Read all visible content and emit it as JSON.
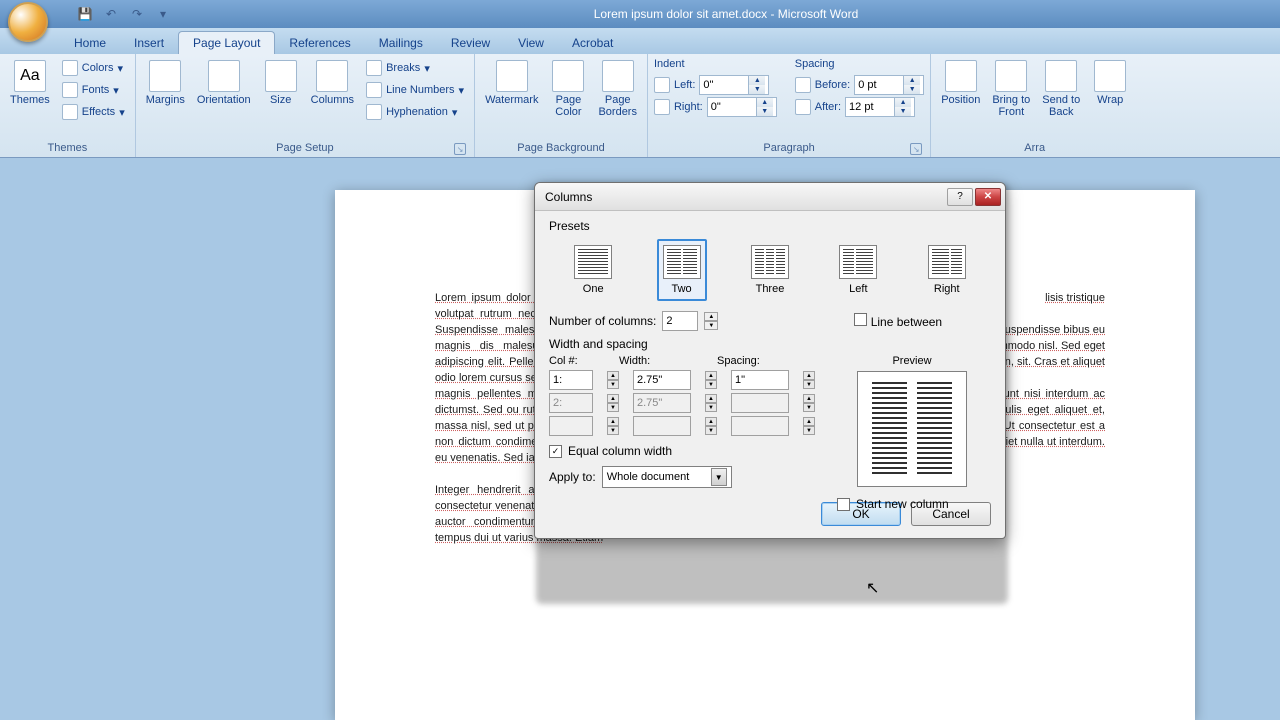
{
  "title": "Lorem ipsum dolor sit amet.docx - Microsoft Word",
  "tabs": [
    "Home",
    "Insert",
    "Page Layout",
    "References",
    "Mailings",
    "Review",
    "View",
    "Acrobat"
  ],
  "active_tab": 2,
  "ribbon": {
    "themes": {
      "label": "Themes",
      "main": "Themes",
      "colors": "Colors",
      "fonts": "Fonts",
      "effects": "Effects"
    },
    "page_setup": {
      "label": "Page Setup",
      "margins": "Margins",
      "orientation": "Orientation",
      "size": "Size",
      "columns": "Columns",
      "breaks": "Breaks",
      "line_numbers": "Line Numbers",
      "hyphenation": "Hyphenation"
    },
    "page_background": {
      "label": "Page Background",
      "watermark": "Watermark",
      "page_color": "Page\nColor",
      "page_borders": "Page\nBorders"
    },
    "paragraph": {
      "label": "Paragraph",
      "indent": "Indent",
      "left": "Left:",
      "right": "Right:",
      "left_val": "0\"",
      "right_val": "0\"",
      "spacing": "Spacing",
      "before": "Before:",
      "after": "After:",
      "before_val": "0 pt",
      "after_val": "12 pt"
    },
    "arrange": {
      "label": "Arra",
      "position": "Position",
      "bring_front": "Bring to\nFront",
      "send_back": "Send to\nBack",
      "wrap": "Wrap"
    }
  },
  "dialog": {
    "title": "Columns",
    "presets_label": "Presets",
    "presets": [
      "One",
      "Two",
      "Three",
      "Left",
      "Right"
    ],
    "selected_preset": 1,
    "num_cols_label": "Number of columns:",
    "num_cols": "2",
    "line_between": "Line between",
    "width_spacing_label": "Width and spacing",
    "col_header": "Col #:",
    "width_header": "Width:",
    "spacing_header": "Spacing:",
    "rows": [
      {
        "num": "1:",
        "width": "2.75\"",
        "spacing": "1\""
      },
      {
        "num": "2:",
        "width": "2.75\"",
        "spacing": ""
      },
      {
        "num": "",
        "width": "",
        "spacing": ""
      }
    ],
    "equal_width": "Equal column width",
    "equal_checked": true,
    "preview_label": "Preview",
    "start_new_col": "Start new column",
    "apply_to_label": "Apply to:",
    "apply_to": "Whole document",
    "ok": "OK",
    "cancel": "Cancel"
  },
  "document": {
    "col1a": "Lorem ipsum dolor sit amet, consectetur adipiscing elit. Proin volutpat rutrum nec nisi faucibus, enim   ac   magna   interdum. Suspendisse malesuada orci volutpat scelerisque orci. Cras magnis dis malesuada orci. Sed eget auctor elementum adipiscing elit. Pellentesque feugiat in. Donec   faucer   mi   urna   in odio lorem cursus sed consequat. Donec dui. Cras magnis dis in magnis pellentes molestie, lacinia, bibendum habitant platea dictumst. Sed ou rutrum vestibulum, ligula semper eget mauris, massa nisl, sed ut porttitor habitant pellentesque  ut   tellus.   Etiam  non dictum condimentum.  Pellentesque lacinia porttitor mauris eu venenatis. Sed iaculis rutrum turpis quis pellentesque.",
    "col1b": "Integer hendrerit augue eu dolor egestas mattis. Praesent consectetur venenatis ligula at feugiat. Curabitur in nunc eget mi auctor condimentum. Ut ut metus mauris. Nullam pretium tempus dui ut varius massa. Etiam",
    "col2a": "lisis tristique",
    "col2b": "tempor, quam sem arcu a leo. sit amet. Suspendisse bibus eu eget etiam. Nullam dolor viverra eget commodo nisl. Sed eget mollis viverra in sapien, sit. Cras et aliquet",
    "col2c": "sapien, quis sed. Donec ultrices leo tincidunt nisi interdum ac dignissim justo posuere. Sed mi sem, iaculis eget aliquet et, porta ut odio. Cras sit amet placerat sem. Ut consectetur est a nibh sagittis feugiat. Integer tincidunt imperdiet nulla ut interdum. Nullam nec risus odio. Etiam"
  }
}
